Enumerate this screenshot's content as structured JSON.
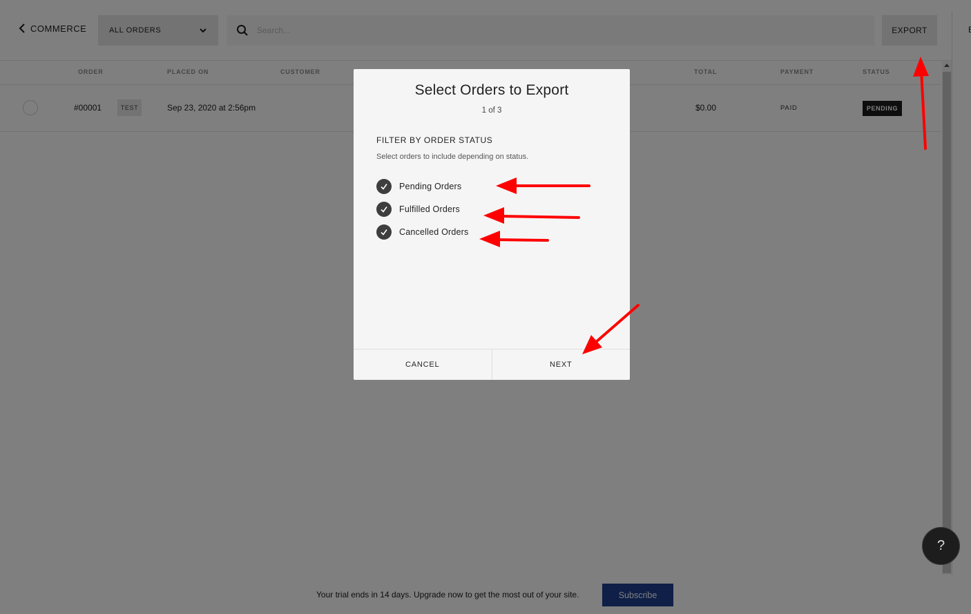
{
  "topbar": {
    "back_label": "COMMERCE",
    "filter_selected": "ALL ORDERS",
    "search_placeholder": "Search...",
    "export_label": "EXPORT",
    "right_panel_letter": "E"
  },
  "table": {
    "columns": [
      "ORDER",
      "PLACED ON",
      "CUSTOMER",
      "TOTAL",
      "PAYMENT",
      "STATUS"
    ],
    "rows": [
      {
        "order": "#00001",
        "badge": "TEST",
        "placed_on": "Sep 23, 2020 at 2:56pm",
        "customer": "",
        "total": "$0.00",
        "payment": "PAID",
        "status": "PENDING"
      }
    ]
  },
  "modal": {
    "title": "Select Orders to Export",
    "step": "1 of 3",
    "section_title": "FILTER BY ORDER STATUS",
    "section_desc": "Select orders to include depending on status.",
    "options": [
      {
        "label": "Pending Orders",
        "checked": true
      },
      {
        "label": "Fulfilled Orders",
        "checked": true
      },
      {
        "label": "Cancelled Orders",
        "checked": true
      }
    ],
    "cancel_label": "CANCEL",
    "next_label": "NEXT"
  },
  "trial": {
    "text": "Your trial ends in 14 days. Upgrade now to get the most out of your site.",
    "subscribe_label": "Subscribe"
  },
  "help": {
    "label": "?"
  },
  "colors": {
    "overlay": "rgba(0,0,0,0.5)",
    "subscribe": "#1e3f8f",
    "status_badge": "#1c1c1c",
    "arrow": "#ff0000",
    "check": "#3e3e3e"
  },
  "icons": [
    "chevron-left-icon",
    "chevron-down-icon",
    "search-icon",
    "checkmark-icon",
    "help-icon",
    "scroll-up-icon"
  ]
}
